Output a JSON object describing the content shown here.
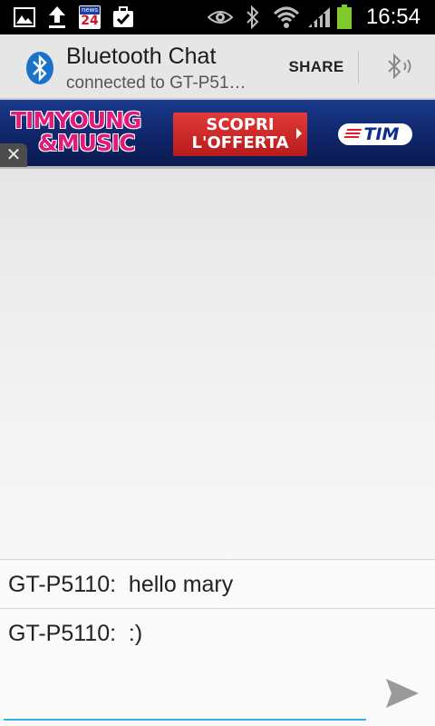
{
  "status_bar": {
    "time": "16:54",
    "notification_icons": [
      "image-icon",
      "upload-icon",
      "news24-icon",
      "briefcase-check-icon"
    ],
    "news_badge_top": "news",
    "news_badge_num": "24",
    "system_icons": [
      "eye-icon",
      "bluetooth-icon",
      "wifi-icon",
      "signal-icon",
      "battery-icon"
    ]
  },
  "action_bar": {
    "app_icon": "bluetooth-icon",
    "title": "Bluetooth Chat",
    "subtitle": "connected to GT-P51…",
    "share_label": "SHARE",
    "discover_icon": "bluetooth-discoverable-icon"
  },
  "ad": {
    "brand_line1": "TIMYOUNG",
    "brand_line2": "&MUSIC",
    "cta_line1": "SCOPRI",
    "cta_line2": "L'OFFERTA",
    "logo": "TIM",
    "close_glyph": "✕"
  },
  "messages": [
    {
      "sender": "GT-P5110",
      "text": "hello mary",
      "display": "GT-P5110:  hello mary"
    },
    {
      "sender": "GT-P5110",
      "text": ":)",
      "display": "GT-P5110:  :)"
    }
  ],
  "compose": {
    "value": "",
    "placeholder": "",
    "send_icon": "send-icon"
  },
  "colors": {
    "status_bar": "#000000",
    "action_bar": "#e6e6e6",
    "accent": "#33b5e5",
    "ad_background": "#0e2466",
    "ad_brand": "#e21a7a",
    "ad_cta": "#c82828",
    "bluetooth_badge": "#1a73c8"
  }
}
